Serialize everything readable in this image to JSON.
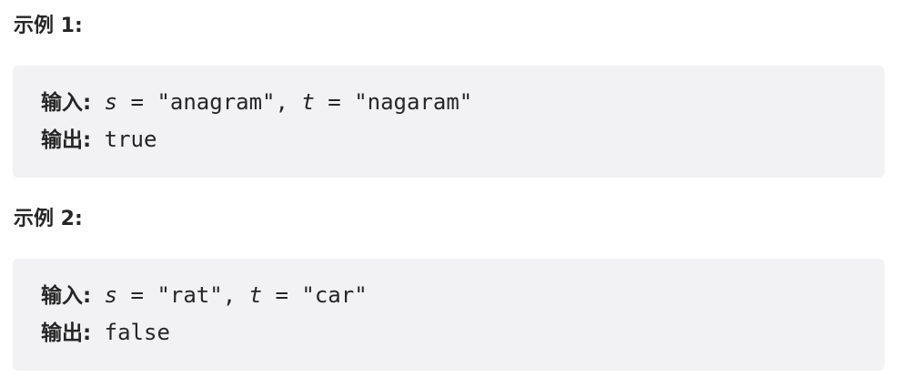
{
  "examples": [
    {
      "heading": "示例 1:",
      "input_label": "输入:",
      "s_var": "s",
      "s_assign": " = \"anagram\", ",
      "t_var": "t",
      "t_assign": " = \"nagaram\"",
      "output_label": "输出:",
      "output_value": "true"
    },
    {
      "heading": "示例 2:",
      "input_label": "输入:",
      "s_var": "s",
      "s_assign": " = \"rat\", ",
      "t_var": "t",
      "t_assign": " = \"car\"",
      "output_label": "输出:",
      "output_value": "false"
    }
  ],
  "colors": {
    "text": "#262626",
    "block_background": "#f2f2f4",
    "page_background": "#ffffff"
  }
}
